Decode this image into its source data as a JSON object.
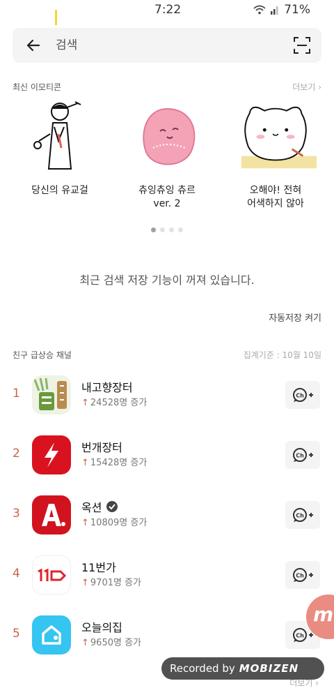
{
  "status_bar": {
    "time": "7:22",
    "battery": "71%"
  },
  "search": {
    "placeholder": "검색"
  },
  "recent_emoticons": {
    "title": "최신 이모티콘",
    "more": "더보기",
    "items": [
      {
        "line1": "당신의 유교걸",
        "line2": ""
      },
      {
        "line1": "츄잉츄잉 츄르",
        "line2": "ver. 2"
      },
      {
        "line1": "오해야! 전혀",
        "line2": "어색하지 않아"
      }
    ]
  },
  "notice": "최근 검색 저장 기능이 꺼져 있습니다.",
  "autosave_label": "자동저장 켜기",
  "channels": {
    "title": "친구 급상승 채널",
    "basis": "집계기준 : 10월 10일",
    "items": [
      {
        "rank": "1",
        "name": "내고향장터",
        "growth": "24528명 증가"
      },
      {
        "rank": "2",
        "name": "번개장터",
        "growth": "15428명 증가"
      },
      {
        "rank": "3",
        "name": "옥션",
        "growth": "10809명 증가"
      },
      {
        "rank": "4",
        "name": "11번가",
        "growth": "9701명 증가"
      },
      {
        "rank": "5",
        "name": "오늘의집",
        "growth": "9650명 증가"
      }
    ],
    "add_label": "Ch+"
  },
  "bottom_more": "더보기",
  "overlay": {
    "recorded_by": "Recorded by",
    "brand": "MOBIZEN",
    "floating_letter": "m"
  },
  "colors": {
    "accent": "#c8644a",
    "search_cursor": "#f7d631"
  }
}
